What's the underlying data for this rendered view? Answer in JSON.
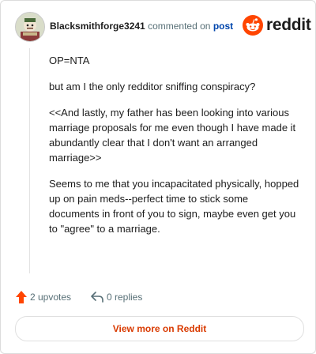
{
  "comment": {
    "username": "Blacksmithforge3241",
    "action_text": "commented on",
    "post_link": "post",
    "paragraphs": [
      "OP=NTA",
      "but am I the only redditor sniffing conspiracy?",
      "<<And lastly, my father has been looking into various marriage proposals for me even though I have made it abundantly clear that I don't want an arranged marriage>>",
      "Seems to me that you incapacitated physically, hopped up on pain meds--perfect time to stick some documents in front of you to sign, maybe even get you to \"agree\" to a marriage."
    ]
  },
  "brand": {
    "name": "reddit",
    "color": "#ff4500"
  },
  "actions": {
    "upvotes": "2 upvotes",
    "replies": "0 replies"
  },
  "view_more": "View more on Reddit",
  "icons": {
    "upvote": "upvote-arrow-icon",
    "reply": "reply-arrow-icon",
    "brand": "reddit-snoo-icon",
    "avatar": "user-avatar-icon"
  },
  "colors": {
    "accent": "#ff4500",
    "link": "#0045ac",
    "muted": "#576f76",
    "view_more": "#d93a00"
  }
}
